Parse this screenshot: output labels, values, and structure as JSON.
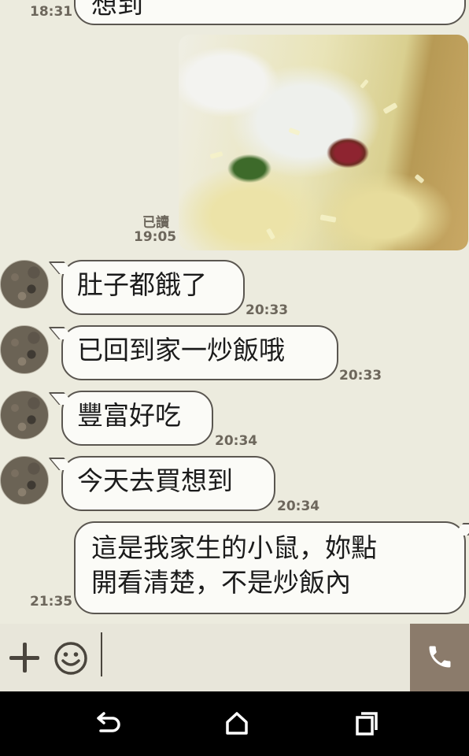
{
  "chat": {
    "partial_message": {
      "text": "想到",
      "time": "18:31"
    },
    "photo_message": {
      "read_label": "已讀",
      "time": "19:05"
    },
    "incoming_messages": [
      {
        "text": "肚子都餓了",
        "time": "20:33"
      },
      {
        "text": "已回到家一炒飯哦",
        "time": "20:33"
      },
      {
        "text": "豐富好吃",
        "time": "20:34"
      },
      {
        "text": "今天去買想到",
        "time": "20:34"
      }
    ],
    "outgoing_message": {
      "line1": "這是我家生的小鼠，妳點",
      "line2": "開看清楚，不是炒飯內",
      "time": "21:35"
    }
  },
  "input_bar": {
    "icons": [
      "plus-icon",
      "smile-icon",
      "phone-icon"
    ],
    "call_color": "#8b7b6b"
  },
  "nav_bar": {
    "icons": [
      "back-icon",
      "home-icon",
      "recents-icon"
    ]
  },
  "colors": {
    "background": "#ecebde",
    "bubble": "#fbfbf7",
    "bubble_border": "#5a5650",
    "time_text": "#6d675c"
  }
}
